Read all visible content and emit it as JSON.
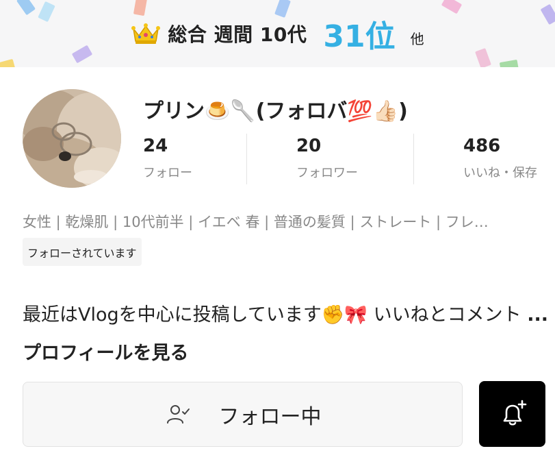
{
  "ranking": {
    "icon": "crown-icon",
    "label": "総合 週間 10代",
    "value": "31位",
    "suffix": "他",
    "accent_color": "#35b0e3"
  },
  "profile": {
    "name": "プリン🍮🥄(フォロバ💯👍🏻)",
    "stats": [
      {
        "count": "24",
        "label": "フォロー"
      },
      {
        "count": "20",
        "label": "フォロワー"
      },
      {
        "count": "486",
        "label": "いいね・保存"
      }
    ],
    "tags": "女性 | 乾燥肌 | 10代前半 | イエベ 春 | 普通の髪質 | ストレート | フレ…",
    "follows_you": "フォローされています",
    "bio_text": "最近はVlogを中心に投稿しています✊🎀 いいねとコメント ",
    "bio_more": "...プロフィールを見る"
  },
  "actions": {
    "follow_label": "フォロー中",
    "follow_icon": "user-check-icon",
    "notify_icon": "bell-plus-icon"
  }
}
